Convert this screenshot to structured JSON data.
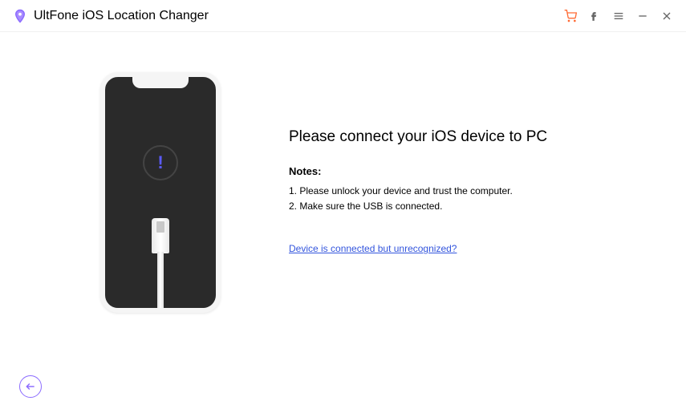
{
  "app": {
    "title": "UltFone iOS Location Changer"
  },
  "main": {
    "headline": "Please connect your iOS device to PC",
    "notes_label": "Notes:",
    "note1": "1. Please unlock your device and trust the computer.",
    "note2": "2. Make sure the USB is connected.",
    "help_link": "Device is connected but unrecognized?"
  }
}
